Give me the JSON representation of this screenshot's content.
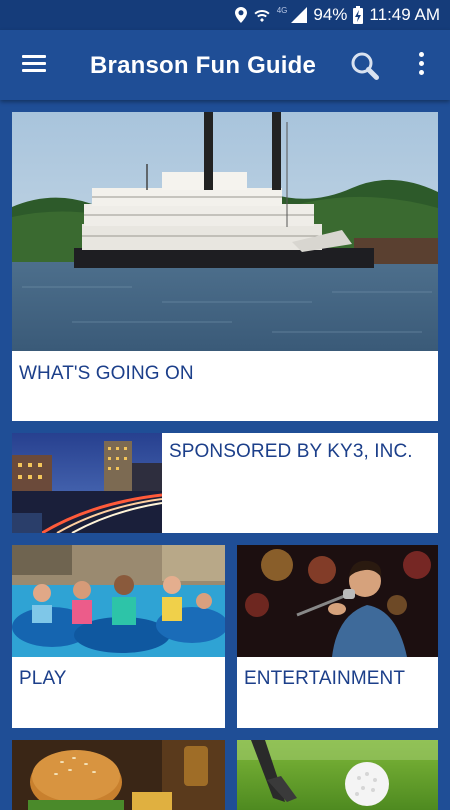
{
  "status_bar": {
    "battery": "94%",
    "time": "11:49 AM",
    "network": "4G"
  },
  "app_bar": {
    "title": "Branson Fun Guide"
  },
  "cards": {
    "whats_going_on": "WHAT'S GOING ON",
    "sponsor": "SPONSORED BY KY3, INC.",
    "play": "PLAY",
    "entertainment": "ENTERTAINMENT"
  },
  "colors": {
    "brand_blue": "#1f4e96",
    "status_blue": "#153c7a",
    "label_blue": "#1c3f8a"
  }
}
